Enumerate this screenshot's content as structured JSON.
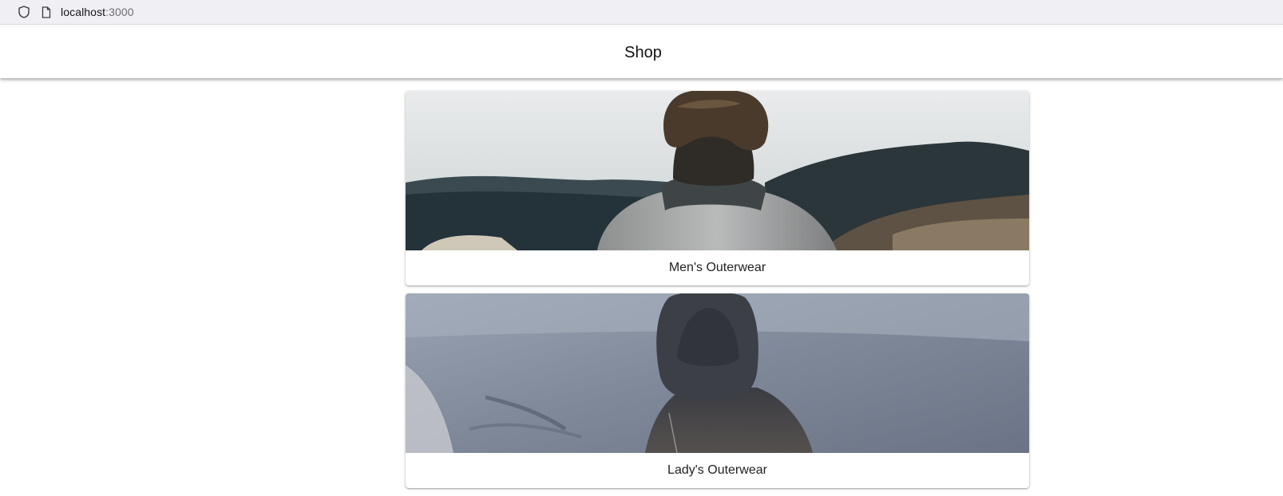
{
  "browser": {
    "host": "localhost",
    "port": ":3000"
  },
  "header": {
    "title": "Shop"
  },
  "categories": [
    {
      "label": "Men's Outerwear",
      "icon": "photo-man-grey-fleece"
    },
    {
      "label": "Lady's Outerwear",
      "icon": "photo-person-dark-hood"
    }
  ],
  "colors": {
    "browser_bar": "#f0f0f4",
    "header_bg": "#ffffff",
    "text": "#222222"
  }
}
